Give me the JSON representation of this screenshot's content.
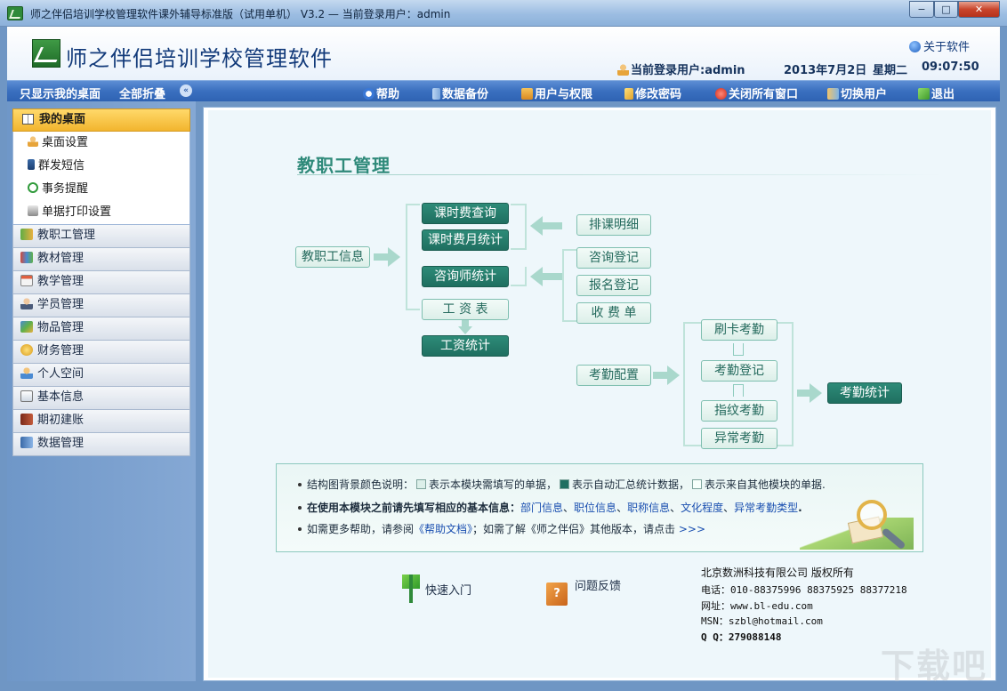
{
  "window": {
    "title": "师之伴侣培训学校管理软件课外辅导标准版（试用单机） V3.2 — 当前登录用户：admin",
    "minimize": "−",
    "maximize": "□",
    "close": "✕"
  },
  "header": {
    "app_name": "师之伴侣培训学校管理软件",
    "about": "关于软件",
    "current_user": "当前登录用户:admin",
    "date": "2013年7月2日",
    "weekday": "星期二",
    "time": "09:07:50"
  },
  "toolbar": {
    "show_desktop_only": "只显示我的桌面",
    "collapse_all": "全部折叠",
    "collapse_icon": "«",
    "help": "帮助",
    "backup": "数据备份",
    "users_permissions": "用户与权限",
    "change_password": "修改密码",
    "close_all_windows": "关闭所有窗口",
    "switch_user": "切换用户",
    "exit": "退出"
  },
  "sidebar": {
    "my_desktop": "我的桌面",
    "desktop_items": [
      "桌面设置",
      "群发短信",
      "事务提醒",
      "单据打印设置"
    ],
    "modules": [
      "教职工管理",
      "教材管理",
      "教学管理",
      "学员管理",
      "物品管理",
      "财务管理",
      "个人空间",
      "基本信息",
      "期初建账",
      "数据管理"
    ]
  },
  "main": {
    "section_title": "教职工管理",
    "flow": {
      "staff_info": "教职工信息",
      "class_fee_query": "课时费查询",
      "class_fee_monthly": "课时费月统计",
      "consultant_stats": "咨询师统计",
      "salary_table": "工 资 表",
      "salary_stats": "工资统计",
      "schedule_detail": "排课明细",
      "consult_register": "咨询登记",
      "enroll_register": "报名登记",
      "fee_receipt": "收 费 单",
      "attendance_config": "考勤配置",
      "card_attendance": "刷卡考勤",
      "attendance_register": "考勤登记",
      "fingerprint_attendance": "指纹考勤",
      "abnormal_attendance": "异常考勤",
      "attendance_stats": "考勤统计"
    },
    "legend": {
      "line1_prefix": "结构图背景颜色说明：",
      "line1_a": "表示本模块需填写的单据，",
      "line1_b": "表示自动汇总统计数据，",
      "line1_c": "表示来自其他模块的单据.",
      "line2_prefix": "在使用本模块之前请先填写相应的基本信息：",
      "line2_links": [
        "部门信息",
        "职位信息",
        "职称信息",
        "文化程度",
        "异常考勤类型"
      ],
      "line2_suffix": ".",
      "line3_a": "如需更多帮助，请参阅",
      "line3_link": "《帮助文档》",
      "line3_b": "；如需了解《师之伴侣》其他版本，请点击",
      "line3_more": ">>>"
    },
    "footer": {
      "quick_start": "快速入门",
      "feedback": "问题反馈",
      "company": "北京数洲科技有限公司  版权所有",
      "phone": "电话：010-88375996 88375925 88377218",
      "website": "网址：www.bl-edu.com",
      "msn": "MSN：szbl@hotmail.com",
      "qq": "Q Q：279088148"
    }
  },
  "watermark": "下载吧",
  "colors": {
    "toolbar": "#3a6fbf",
    "dark_box": "#1f6f60",
    "light_box": "#dcefe9",
    "active_nav": "#f2b52e"
  }
}
